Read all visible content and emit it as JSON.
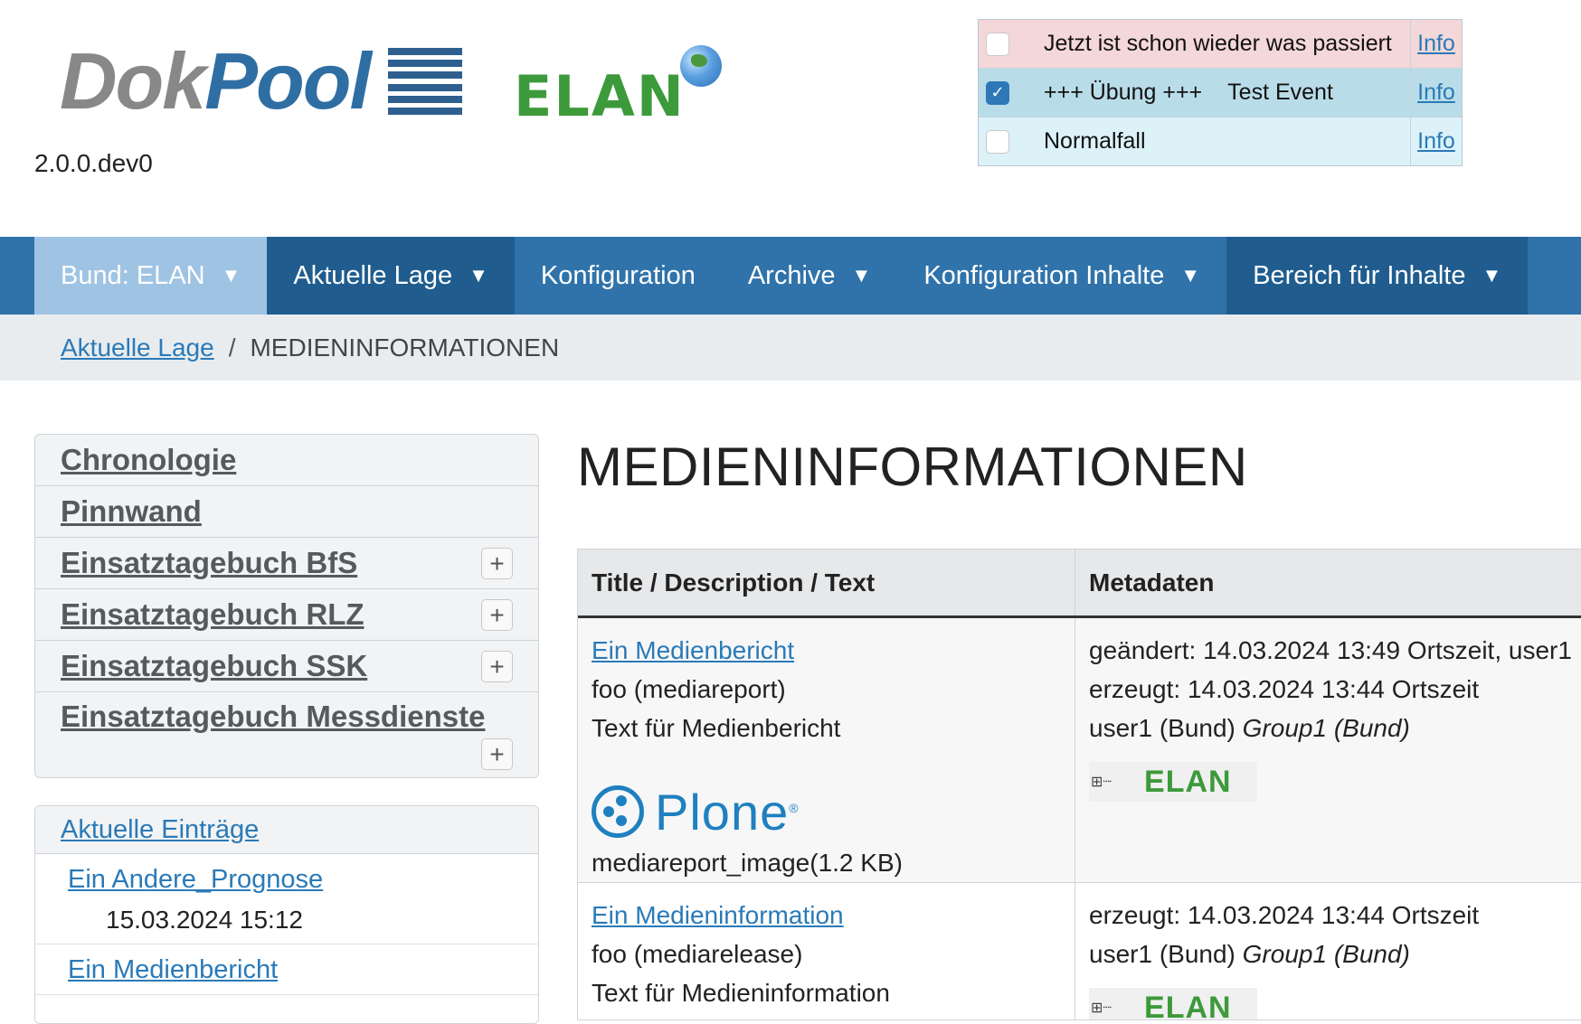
{
  "header": {
    "logo_dok": "Dok",
    "logo_pool": "Pool",
    "logo_elan": "ELAN",
    "version": "2.0.0.dev0"
  },
  "events": [
    {
      "title": "Jetzt ist schon wieder was passiert",
      "title_extra": "",
      "checked": false,
      "info": "Info"
    },
    {
      "title": "+++ Übung +++",
      "title_extra": "Test Event",
      "checked": true,
      "info": "Info"
    },
    {
      "title": "Normalfall",
      "title_extra": "",
      "checked": false,
      "info": "Info"
    }
  ],
  "navbar": {
    "items": [
      {
        "label": "Bund: ELAN",
        "dropdown": true
      },
      {
        "label": "Aktuelle Lage",
        "dropdown": true
      },
      {
        "label": "Konfiguration",
        "dropdown": false
      },
      {
        "label": "Archive",
        "dropdown": true
      },
      {
        "label": "Konfiguration Inhalte",
        "dropdown": true
      },
      {
        "label": "Bereich für Inhalte",
        "dropdown": true
      }
    ],
    "caret": "▼"
  },
  "breadcrumb": {
    "parent": "Aktuelle Lage",
    "separator": "/",
    "current": "MEDIENINFORMATIONEN"
  },
  "sidebar": {
    "items": [
      {
        "label": "Chronologie",
        "expandable": false
      },
      {
        "label": "Pinnwand",
        "expandable": false
      },
      {
        "label": "Einsatztagebuch BfS",
        "expandable": true
      },
      {
        "label": "Einsatztagebuch RLZ",
        "expandable": true
      },
      {
        "label": "Einsatztagebuch SSK",
        "expandable": true
      },
      {
        "label": "Einsatztagebuch Messdienste",
        "expandable": true
      }
    ],
    "expand_symbol": "+"
  },
  "portlet": {
    "title": "Aktuelle Einträge",
    "entries": [
      {
        "title": "Ein Andere_Prognose",
        "date": "15.03.2024 15:12"
      },
      {
        "title": "Ein Medienbericht",
        "date": ""
      }
    ]
  },
  "main": {
    "title": "MEDIENINFORMATIONEN",
    "table": {
      "headers": [
        "Title / Description / Text",
        "Metadaten"
      ],
      "rows": [
        {
          "title": "Ein Medienbericht",
          "description": "foo (mediareport)",
          "text": "Text für Medienbericht",
          "image_brand": "Plone",
          "image_registered": "®",
          "image_label": "mediareport_image(1.2 KB)",
          "changed": "geändert: 14.03.2024 13:49 Ortszeit, user1",
          "created": "erzeugt: 14.03.2024 13:44 Ortszeit",
          "user": "user1 (Bund)",
          "group": "Group1 (Bund)",
          "meta_logo": "ELAN"
        },
        {
          "title": "Ein Medieninformation",
          "description": "foo (mediarelease)",
          "text": "Text für Medieninformation",
          "created": "erzeugt: 14.03.2024 13:44 Ortszeit",
          "user": "user1 (Bund)",
          "group": "Group1 (Bund)",
          "meta_logo": "ELAN"
        }
      ]
    }
  },
  "colors": {
    "nav_bg": "#3073aa",
    "nav_active": "#9fc3e3",
    "nav_dark": "#205d8e",
    "link": "#2a7ab8",
    "elan_green": "#3d9a3b",
    "plone_blue": "#1f80c0"
  },
  "icons": {
    "checked": "check-icon",
    "tree": "tree-expand-icon",
    "globe": "globe-icon"
  }
}
